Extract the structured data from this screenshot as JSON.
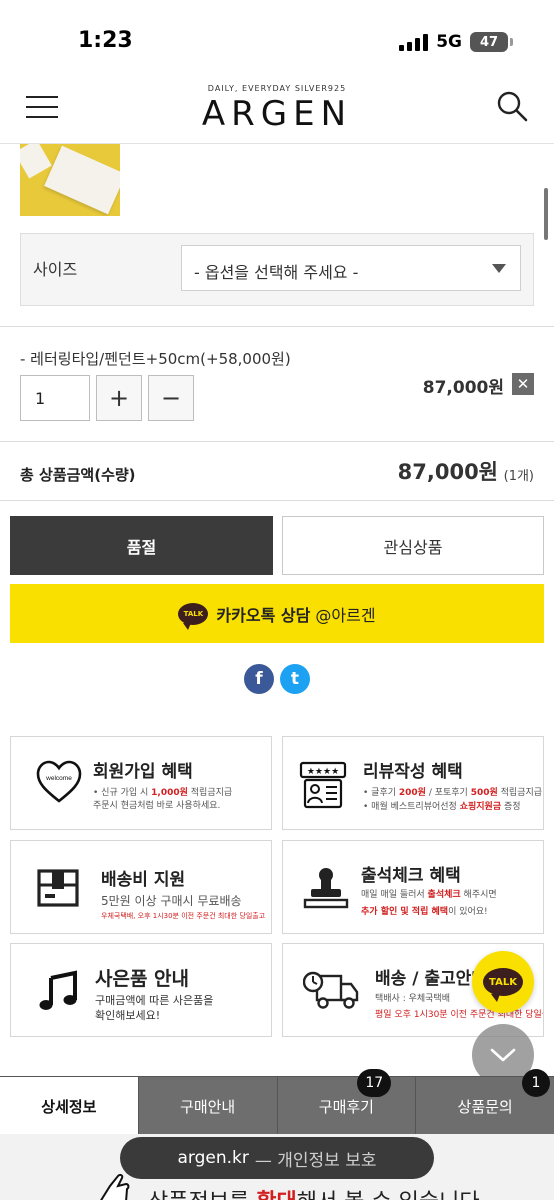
{
  "status_bar": {
    "time": "1:23",
    "network": "5G",
    "battery": "47"
  },
  "header": {
    "logo_subtitle": "DAILY, EVERYDAY SILVER925",
    "logo": "ARGEN"
  },
  "option": {
    "label": "사이즈",
    "select_value": "- 옵션을 선택해 주세요 -"
  },
  "selected_item": {
    "name": "- 레터링타입/펜던트+50cm(+58,000원)",
    "quantity": "1",
    "plus": "+",
    "minus": "−",
    "price": "87,000원",
    "remove": "✕"
  },
  "total": {
    "label": "총 상품금액(수량)",
    "price": "87,000원",
    "count": "(1개)"
  },
  "buttons": {
    "soldout": "품절",
    "wishlist": "관심상품",
    "kakao_badge": "TALK",
    "kakao_bold": "카카오톡 상담",
    "kakao_handle": " @아르겐"
  },
  "social": {
    "facebook": "f",
    "twitter": "t"
  },
  "benefits": {
    "signup": {
      "title": "회원가입 혜택",
      "line1_pre": "• 신규 가입 시 ",
      "line1_hl": "1,000원",
      "line1_post": " 적립금지급",
      "line2": "주문시 현금처럼 바로 사용하세요.",
      "icon_text": "welcome"
    },
    "review": {
      "title": "리뷰작성 혜택",
      "line1_pre": "• 글후기 ",
      "line1_hl1": "200원",
      "line1_mid": " / 포토후기 ",
      "line1_hl2": "500원",
      "line1_post": " 적립금지급",
      "line2_pre": "• 매월 베스트리뷰어선정 ",
      "line2_hl": "쇼핑지원금",
      "line2_post": " 증정"
    },
    "shipping": {
      "title": "배송비 지원",
      "line1": "5만원 이상 구매시 무료배송",
      "line2": "우체국택배, 오후 1시30분 이전 주문건 최대한 당일출고"
    },
    "attendance": {
      "title": "출석체크 혜택",
      "line1_pre": "매일 매일 들러서 ",
      "line1_hl": "출석체크",
      "line1_post": " 해주시면",
      "line2_hl": "추가 할인 및 적립 혜택",
      "line2_post": "이 있어요!"
    },
    "gift": {
      "title": "사은품 안내",
      "line1": "구매금액에 따른 사은품을",
      "line2": "확인해보세요!"
    },
    "delivery": {
      "title": "배송 / 출고안내",
      "line1": "택배사 : 우체국택배",
      "line2": "평일 오후 1시30분 이전 주문건 최대한 당일출고"
    }
  },
  "fab": {
    "talk": "TALK"
  },
  "tabs": [
    {
      "label": "상세정보"
    },
    {
      "label": "구매안내"
    },
    {
      "label": "구매후기",
      "badge": "17"
    },
    {
      "label": "상품문의",
      "badge": "1"
    }
  ],
  "browser": {
    "domain": "argen.kr",
    "privacy": "— 개인정보 보호"
  },
  "bottom": {
    "pre": "상품정보를 ",
    "hl": "확대",
    "post": "해서 볼 수 있습니다"
  },
  "colors": {
    "kakao_yellow": "#f9e000",
    "soldout_bg": "#3b3b3b",
    "tab_bg": "#6e6e6e",
    "highlight_red": "#d21f1f"
  }
}
